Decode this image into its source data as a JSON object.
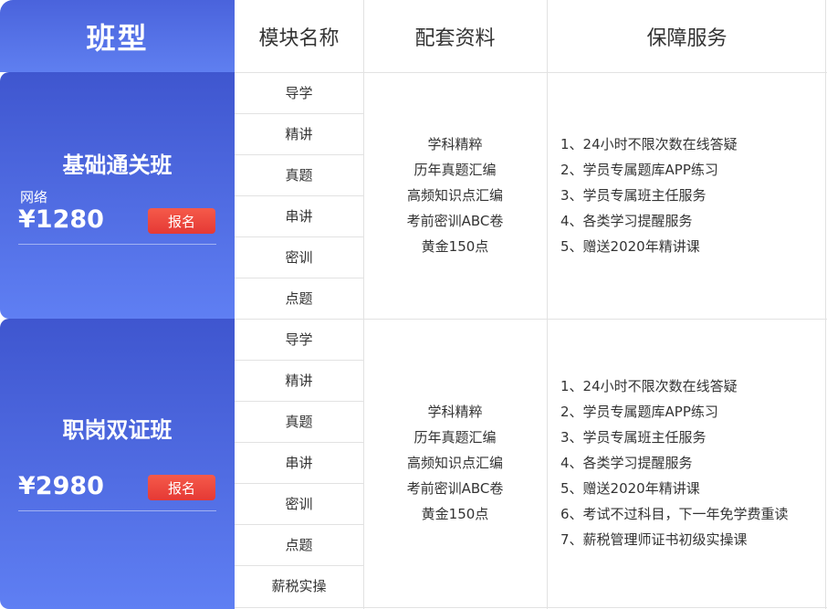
{
  "header": {
    "type_label": "班型",
    "module_label": "模块名称",
    "materials_label": "配套资料",
    "services_label": "保障服务"
  },
  "classes": [
    {
      "name": "基础通关班",
      "sub_label": "网络",
      "price": "¥1280",
      "signup_label": "报名",
      "modules": [
        "导学",
        "精讲",
        "真题",
        "串讲",
        "密训",
        "点题"
      ],
      "materials": [
        "学科精粹",
        "历年真题汇编",
        "高频知识点汇编",
        "考前密训ABC卷",
        "黄金150点"
      ],
      "services": [
        "1、24小时不限次数在线答疑",
        "2、学员专属题库APP练习",
        "3、学员专属班主任服务",
        "4、各类学习提醒服务",
        "5、赠送2020年精讲课"
      ]
    },
    {
      "name": "职岗双证班",
      "sub_label": "",
      "price": "¥2980",
      "signup_label": "报名",
      "modules": [
        "导学",
        "精讲",
        "真题",
        "串讲",
        "密训",
        "点题",
        "薪税实操"
      ],
      "materials": [
        "学科精粹",
        "历年真题汇编",
        "高频知识点汇编",
        "考前密训ABC卷",
        "黄金150点"
      ],
      "services": [
        "1、24小时不限次数在线答疑",
        "2、学员专属题库APP练习",
        "3、学员专属班主任服务",
        "4、各类学习提醒服务",
        "5、赠送2020年精讲课",
        "6、考试不过科目，下一年免学费重读",
        "7、薪税管理师证书初级实操课"
      ]
    }
  ]
}
